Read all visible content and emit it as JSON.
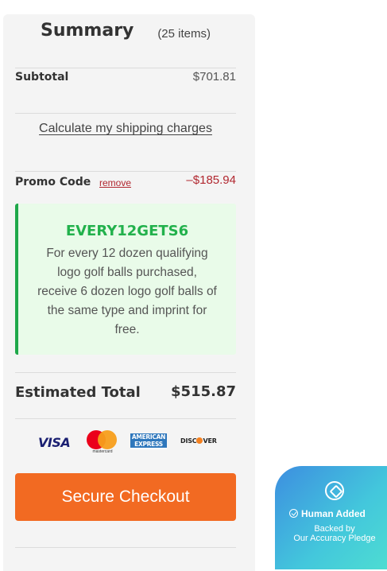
{
  "summary": {
    "title": "Summary",
    "count": "(25 items)"
  },
  "subtotal": {
    "label": "Subtotal",
    "value": "$701.81"
  },
  "shipping": {
    "link": "Calculate my shipping charges"
  },
  "promo": {
    "label": "Promo Code",
    "remove": "remove",
    "discount": "–$185.94",
    "code": "EVERY12GETS6",
    "description": "For every 12 dozen qualifying logo golf balls purchased, receive 6 dozen logo golf balls of the same type and imprint for free."
  },
  "estimated": {
    "label": "Estimated Total",
    "value": "$515.87"
  },
  "payment": {
    "visa": "VISA",
    "mastercard": "mastercard",
    "amex_line1": "AMERICAN",
    "amex_line2": "EXPRESS",
    "discover_a": "DISC",
    "discover_b": "VER"
  },
  "checkout": {
    "label": "Secure Checkout"
  },
  "badge": {
    "title": "Human Added",
    "line1": "Backed by",
    "line2": "Our Accuracy Pledge"
  },
  "colors": {
    "accent": "#f26a22",
    "promo_green": "#22b14c",
    "promo_bg": "#e9fbe9",
    "discount_red": "#b1272f"
  }
}
